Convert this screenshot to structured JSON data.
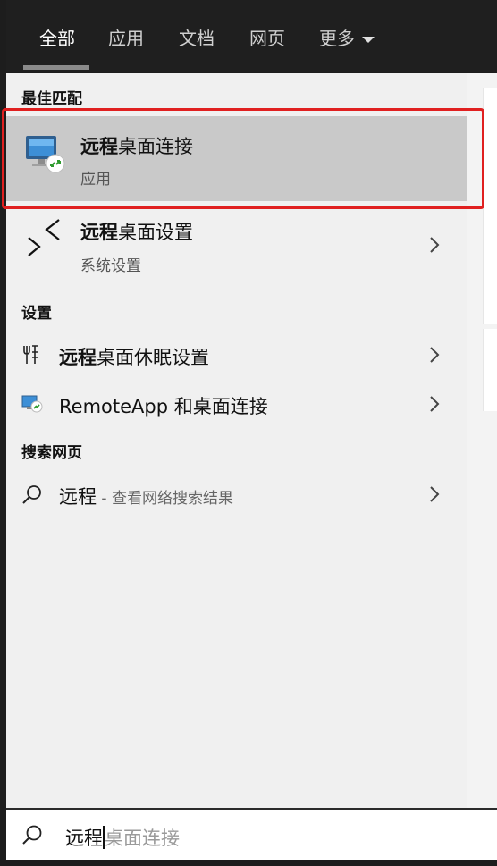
{
  "tabs": [
    {
      "label": "全部",
      "active": true
    },
    {
      "label": "应用"
    },
    {
      "label": "文档"
    },
    {
      "label": "网页"
    },
    {
      "label": "更多"
    }
  ],
  "sections": {
    "best_match": "最佳匹配",
    "settings": "设置",
    "web": "搜索网页"
  },
  "best_match": {
    "title_bold": "远程",
    "title_rest": "桌面连接",
    "subtitle": "应用",
    "icon": "remote-desktop-connection-icon"
  },
  "rd_settings": {
    "title_bold": "远程",
    "title_rest": "桌面设置",
    "subtitle": "系统设置",
    "icon": "remote-desktop-settings-icon"
  },
  "settings_items": [
    {
      "bold": "远程",
      "rest": "桌面休眠设置",
      "icon": "sleep-settings-icon"
    },
    {
      "bold": "",
      "rest": "RemoteApp 和桌面连接",
      "icon": "remoteapp-icon"
    }
  ],
  "web_item": {
    "query": "远程",
    "suffix": " - 查看网络搜索结果",
    "icon": "search-icon"
  },
  "search": {
    "typed": "远程",
    "ghost": "桌面连接",
    "icon": "search-icon"
  },
  "colors": {
    "highlight_border": "#e02020",
    "selected_bg": "#c9c9c9",
    "panel_bg": "#f0f0f0",
    "topbar_bg": "#1f1f1f"
  }
}
